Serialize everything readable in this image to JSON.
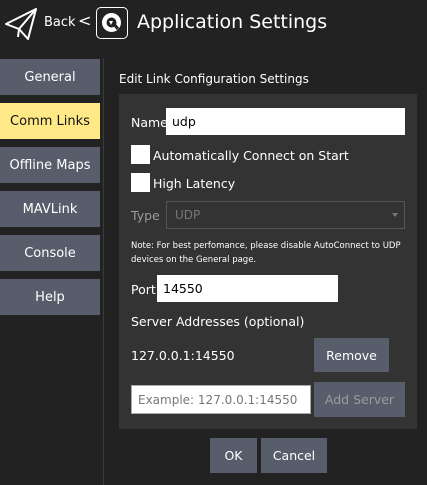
{
  "header": {
    "back_label": "Back",
    "back_separator": "<",
    "title": "Application Settings",
    "icons": [
      "paper-plane-icon",
      "qgc-logo-icon"
    ]
  },
  "sidebar": {
    "items": [
      {
        "label": "General",
        "active": false
      },
      {
        "label": "Comm Links",
        "active": true
      },
      {
        "label": "Offline Maps",
        "active": false
      },
      {
        "label": "MAVLink",
        "active": false
      },
      {
        "label": "Console",
        "active": false
      },
      {
        "label": "Help",
        "active": false
      }
    ]
  },
  "form": {
    "section_title": "Edit Link Configuration Settings",
    "name_label": "Name",
    "name_value": "udp",
    "auto_connect_label": "Automatically Connect on Start",
    "auto_connect_checked": false,
    "high_latency_label": "High Latency",
    "high_latency_checked": false,
    "type_label": "Type",
    "type_value": "UDP",
    "note": "Note: For best perfomance, please disable AutoConnect to UDP devices on the General page.",
    "port_label": "Port",
    "port_value": "14550",
    "server_addresses_label": "Server Addresses (optional)",
    "server_address": "127.0.0.1:14550",
    "remove_label": "Remove",
    "server_placeholder": "Example: 127.0.0.1:14550",
    "add_server_label": "Add Server"
  },
  "footer": {
    "ok_label": "OK",
    "cancel_label": "Cancel"
  },
  "colors": {
    "background": "#222222",
    "panel": "#333333",
    "button": "#585d6b",
    "active_tab": "#ffe987"
  }
}
